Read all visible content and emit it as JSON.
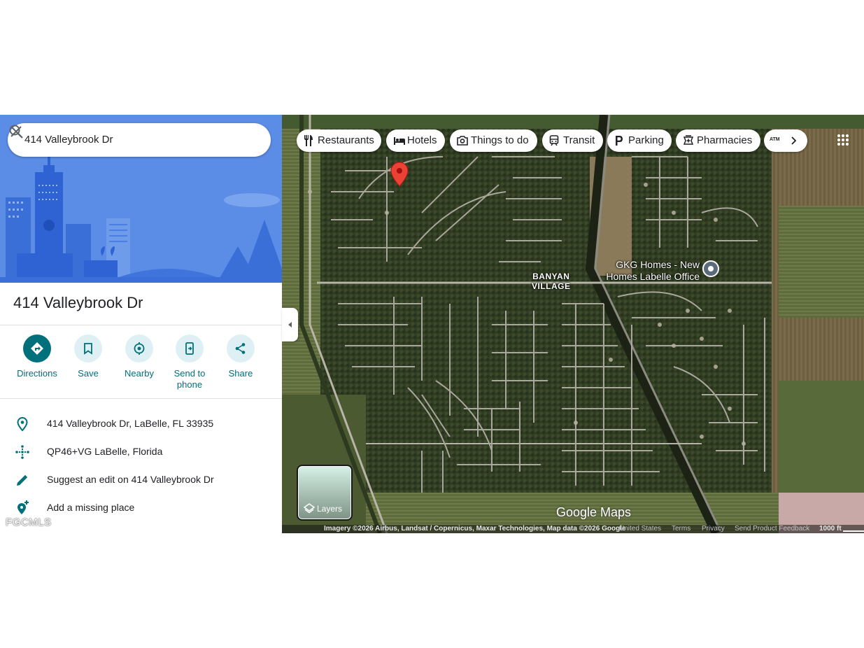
{
  "search": {
    "query": "414 Valleybrook Dr"
  },
  "place": {
    "title": "414 Valleybrook Dr"
  },
  "actions": [
    {
      "label": "Directions",
      "icon": "directions-icon"
    },
    {
      "label": "Save",
      "icon": "bookmark-icon"
    },
    {
      "label": "Nearby",
      "icon": "nearby-icon"
    },
    {
      "label": "Send to phone",
      "icon": "send-to-phone-icon"
    },
    {
      "label": "Share",
      "icon": "share-icon"
    }
  ],
  "info": [
    {
      "text": "414 Valleybrook Dr, LaBelle, FL 33935",
      "icon": "location-pin-icon"
    },
    {
      "text": "QP46+VG LaBelle, Florida",
      "icon": "plus-code-icon"
    },
    {
      "text": "Suggest an edit on 414 Valleybrook Dr",
      "icon": "pencil-icon"
    },
    {
      "text": "Add a missing place",
      "icon": "add-place-icon"
    }
  ],
  "watermark": "FGCMLS",
  "chips": [
    {
      "label": "Restaurants",
      "icon": "restaurant-icon"
    },
    {
      "label": "Hotels",
      "icon": "hotel-icon"
    },
    {
      "label": "Things to do",
      "icon": "camera-icon"
    },
    {
      "label": "Transit",
      "icon": "train-icon"
    },
    {
      "label": "Parking",
      "icon": "parking-icon"
    },
    {
      "label": "Pharmacies",
      "icon": "pharmacy-icon"
    },
    {
      "label": "ATM",
      "icon": "atm-icon"
    }
  ],
  "map": {
    "area_label_line1": "BANYAN",
    "area_label_line2": "VILLAGE",
    "poi_line1": "GKG Homes - New",
    "poi_line2": "Homes Labelle Office",
    "logo": "Google Maps",
    "layers_label": "Layers"
  },
  "attribution": {
    "imagery": "Imagery ©2026 Airbus, Landsat / Copernicus, Maxar Technologies, Map data ©2026 Google",
    "country": "United States",
    "terms": "Terms",
    "privacy": "Privacy",
    "feedback": "Send Product Feedback",
    "scale": "1000 ft"
  },
  "colors": {
    "accent": "#00707a",
    "hero_blue": "#4a7fe0",
    "pin_red": "#ea4335"
  }
}
